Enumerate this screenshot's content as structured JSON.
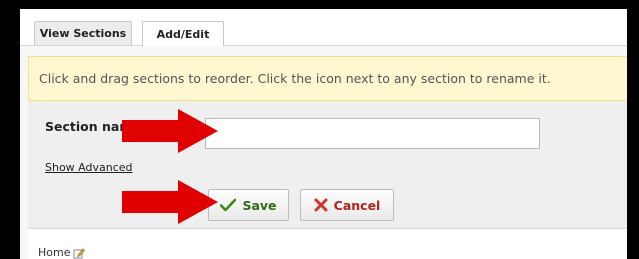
{
  "tabs": [
    {
      "label": "View Sections"
    },
    {
      "label": "Add/Edit"
    }
  ],
  "notice": {
    "text": "Click and drag sections to reorder. Click the icon next to any section to rename it."
  },
  "form": {
    "section_name_label": "Section name:",
    "section_name_value": "",
    "show_advanced_label": "Show Advanced",
    "save_label": "Save",
    "cancel_label": "Cancel"
  },
  "footer": {
    "home_label": "Home"
  },
  "colors": {
    "arrow": "#e00000",
    "notice_bg": "#fff7cf",
    "save_text": "#2e6b11",
    "cancel_text": "#b0241b"
  },
  "icons": {
    "save": "checkmark-icon",
    "cancel": "x-icon",
    "edit": "pencil-icon",
    "annotation": "red-arrow-icon"
  }
}
